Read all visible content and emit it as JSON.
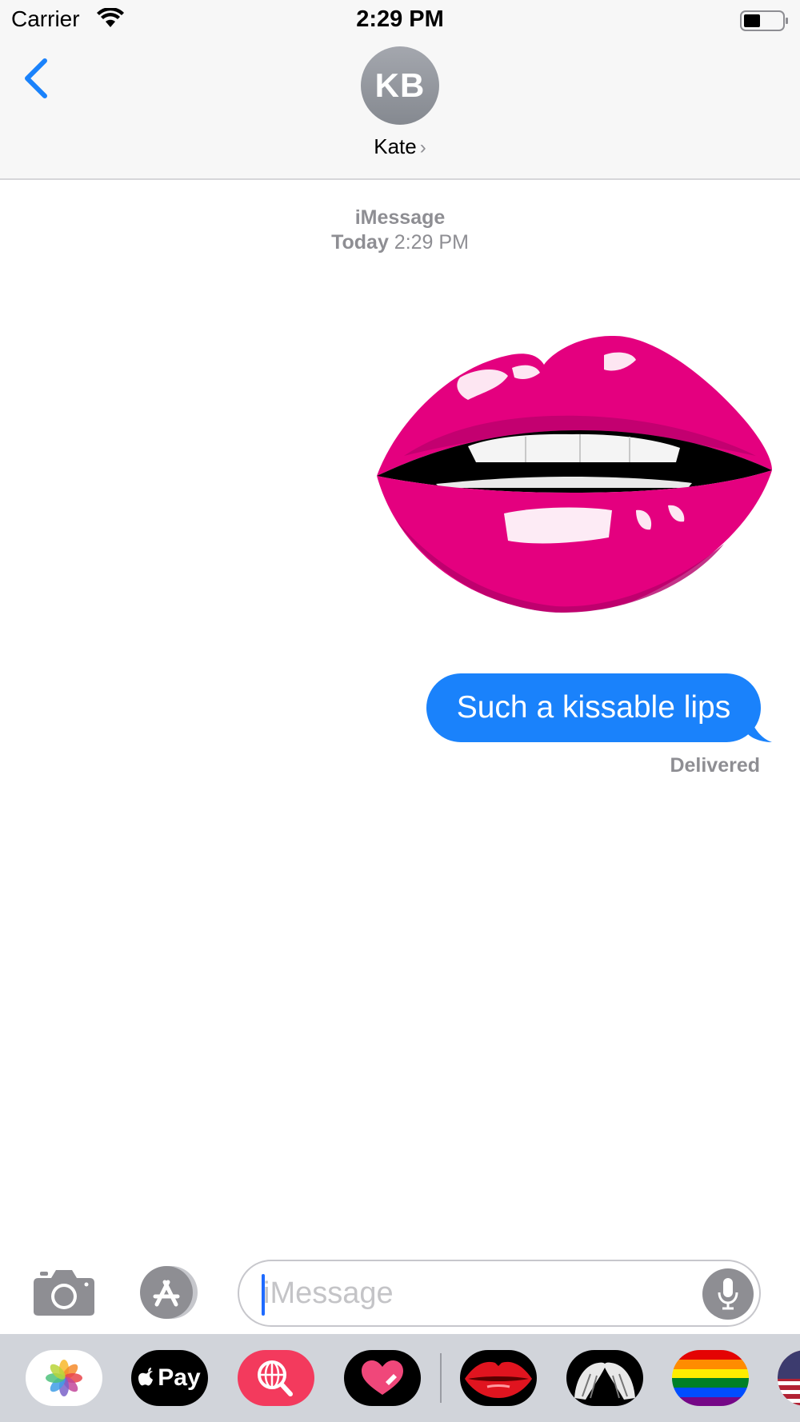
{
  "status_bar": {
    "carrier": "Carrier",
    "time": "2:29 PM",
    "wifi_icon": "wifi-icon",
    "battery_icon": "battery-icon"
  },
  "header": {
    "back_icon": "chevron-left-icon",
    "avatar_initials": "KB",
    "contact_name": "Kate",
    "contact_chevron": "›"
  },
  "conversation": {
    "service": "iMessage",
    "timestamp_day": "Today",
    "timestamp_time": "2:29 PM",
    "sticker": "pink-lips-sticker",
    "message_text": "Such a kissable lips",
    "message_status": "Delivered"
  },
  "input_bar": {
    "camera_icon": "camera-icon",
    "apps_icon": "app-store-icon",
    "placeholder": "iMessage",
    "value": "",
    "mic_icon": "microphone-icon"
  },
  "app_drawer": {
    "apps": [
      {
        "name": "photos",
        "icon": "photos-icon"
      },
      {
        "name": "apple-pay",
        "label": "Pay",
        "icon": "apple-pay-icon"
      },
      {
        "name": "search-images",
        "icon": "globe-search-icon"
      },
      {
        "name": "digital-touch",
        "icon": "heart-icon"
      },
      {
        "name": "red-lips-stickers",
        "icon": "red-lips-icon"
      },
      {
        "name": "hair-stickers",
        "icon": "hair-icon"
      },
      {
        "name": "rainbow-flag-stickers",
        "icon": "rainbow-flag-icon"
      },
      {
        "name": "us-flag-stickers",
        "icon": "us-flag-icon"
      }
    ]
  },
  "colors": {
    "accent": "#1a82fb",
    "lips": "#e4007f",
    "gray_text": "#8e8e93"
  }
}
